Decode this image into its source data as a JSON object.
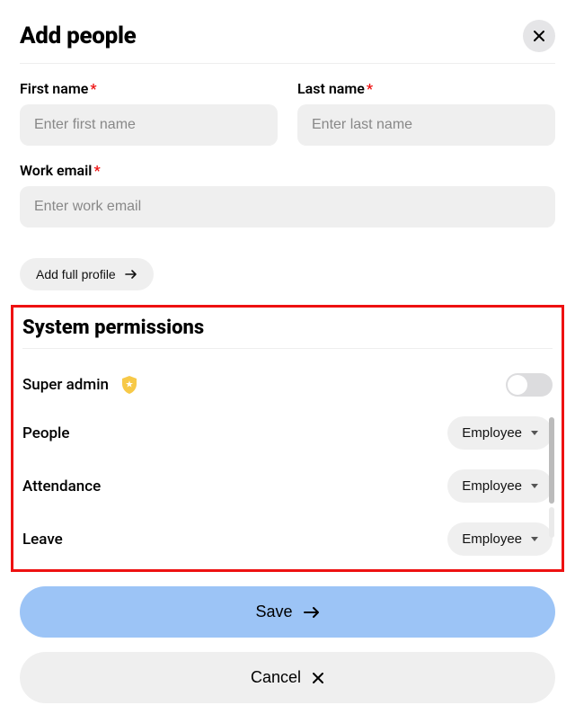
{
  "title": "Add people",
  "fields": {
    "first_name": {
      "label": "First name",
      "placeholder": "Enter first name",
      "value": "",
      "required": true
    },
    "last_name": {
      "label": "Last name",
      "placeholder": "Enter last name",
      "value": "",
      "required": true
    },
    "work_email": {
      "label": "Work email",
      "placeholder": "Enter work email",
      "value": "",
      "required": true
    }
  },
  "add_full_profile_label": "Add full profile",
  "permissions": {
    "heading": "System permissions",
    "super_admin": {
      "label": "Super admin",
      "on": false
    },
    "rows": [
      {
        "label": "People",
        "value": "Employee"
      },
      {
        "label": "Attendance",
        "value": "Employee"
      },
      {
        "label": "Leave",
        "value": "Employee"
      }
    ]
  },
  "buttons": {
    "save": "Save",
    "cancel": "Cancel"
  }
}
